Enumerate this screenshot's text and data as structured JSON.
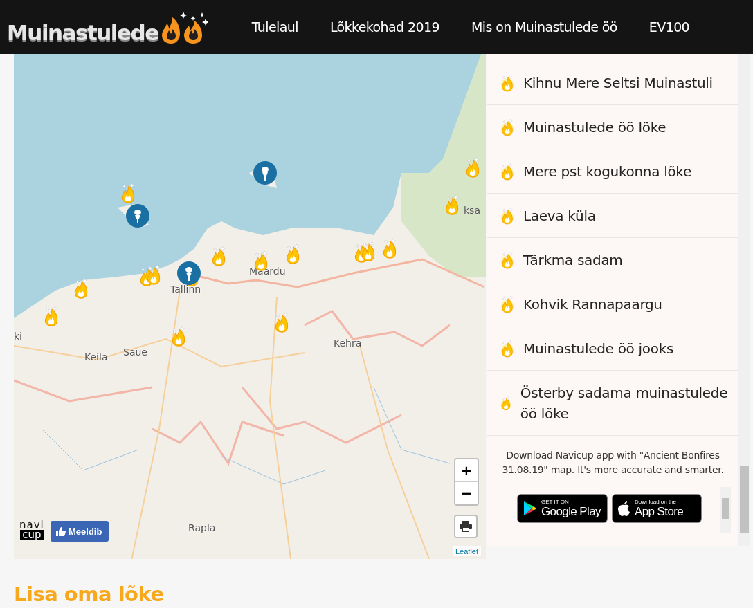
{
  "header": {
    "logo": "Muinastulede",
    "nav": [
      {
        "label": "Tulelaul"
      },
      {
        "label": "Lõkkekohad 2019"
      },
      {
        "label": "Mis on Muinastulede öö"
      },
      {
        "label": "EV100"
      }
    ]
  },
  "map": {
    "labels": [
      "Maardu",
      "Tallinn",
      "Keila",
      "Saue",
      "Kehra",
      "Rapla",
      "ksa",
      "ki"
    ],
    "zoom_in": "+",
    "zoom_out": "−",
    "like_button": "Meeldib",
    "navicup_logo": [
      "navi",
      "cup"
    ],
    "attribution": "Leaflet"
  },
  "places": [
    {
      "name": "Kihnu Mere Seltsi Muinastuli"
    },
    {
      "name": "Muinastulede öö lõke"
    },
    {
      "name": "Mere pst kogukonna lõke"
    },
    {
      "name": "Laeva küla"
    },
    {
      "name": "Tärkma sadam"
    },
    {
      "name": "Kohvik Rannapaargu"
    },
    {
      "name": "Muinastulede öö jooks"
    },
    {
      "name": "Österby sadama muinastulede öö lõke"
    }
  ],
  "promo": {
    "text": "Download Navicup app with \"Ancient Bonfires 31.08.19\" map. It's more accurate and smarter.",
    "google_play": {
      "small": "GET IT ON",
      "large": "Google Play"
    },
    "app_store": {
      "small": "Download on the",
      "large": "App Store"
    }
  },
  "heading": "Lisa oma lõke"
}
